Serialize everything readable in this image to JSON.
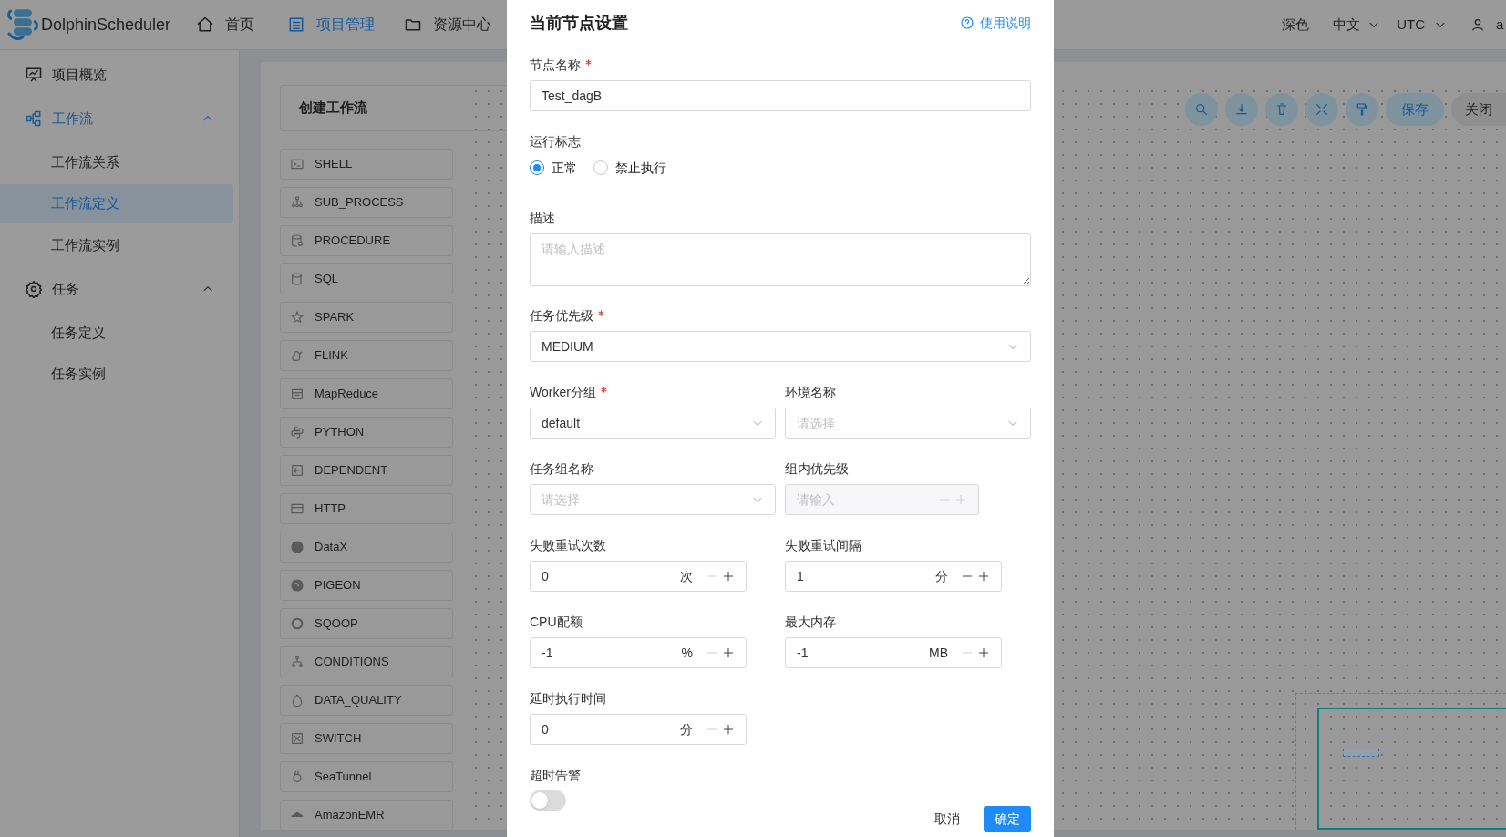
{
  "header": {
    "logo": "DolphinScheduler",
    "nav": [
      {
        "label": "首页",
        "selected": false
      },
      {
        "label": "项目管理",
        "selected": true
      },
      {
        "label": "资源中心",
        "selected": false
      }
    ],
    "theme": "深色",
    "language": "中文",
    "timezone": "UTC",
    "user": "a"
  },
  "sidebar": {
    "items": [
      {
        "label": "项目概览",
        "selected": false
      },
      {
        "label": "工作流",
        "expanded": true,
        "selected": true,
        "children": [
          {
            "label": "工作流关系",
            "selected": false
          },
          {
            "label": "工作流定义",
            "selected": true
          },
          {
            "label": "工作流实例",
            "selected": false
          }
        ]
      },
      {
        "label": "任务",
        "expanded": true,
        "selected": false,
        "children": [
          {
            "label": "任务定义",
            "selected": false
          },
          {
            "label": "任务实例",
            "selected": false
          }
        ]
      }
    ]
  },
  "toolbox": {
    "title": "创建工作流",
    "tools": [
      "SHELL",
      "SUB_PROCESS",
      "PROCEDURE",
      "SQL",
      "SPARK",
      "FLINK",
      "MapReduce",
      "PYTHON",
      "DEPENDENT",
      "HTTP",
      "DataX",
      "PIGEON",
      "SQOOP",
      "CONDITIONS",
      "DATA_QUALITY",
      "SWITCH",
      "SeaTunnel",
      "AmazonEMR"
    ]
  },
  "canvas_toolbar": {
    "buttons": [
      {
        "label": "保存",
        "kind": "primary"
      },
      {
        "label": "关闭",
        "kind": "plain"
      }
    ]
  },
  "drawer": {
    "title": "当前节点设置",
    "help": "使用说明",
    "fields": [
      {
        "kind": "text",
        "label": "节点名称",
        "required": true,
        "value": "Test_dagB"
      },
      {
        "kind": "radio",
        "label": "运行标志",
        "options": [
          {
            "label": "正常",
            "selected": true
          },
          {
            "label": "禁止执行",
            "selected": false
          }
        ]
      },
      {
        "kind": "textarea",
        "label": "描述",
        "placeholder": "请输入描述"
      },
      {
        "kind": "select",
        "label": "任务优先级",
        "required": true,
        "value": "MEDIUM"
      },
      {
        "kind": "row",
        "fields": [
          {
            "kind": "select",
            "label": "Worker分组",
            "required": true,
            "value": "default"
          },
          {
            "kind": "select",
            "label": "环境名称",
            "placeholder": "请选择"
          }
        ]
      },
      {
        "kind": "row",
        "fields": [
          {
            "kind": "select",
            "label": "任务组名称",
            "placeholder": "请选择"
          },
          {
            "kind": "number",
            "label": "组内优先级",
            "placeholder": "请输入",
            "disabled": true,
            "decrement_disabled": true
          }
        ]
      },
      {
        "kind": "row",
        "fields": [
          {
            "kind": "number",
            "label": "失败重试次数",
            "value": "0",
            "unit": "次",
            "decrement_disabled": true
          },
          {
            "kind": "number",
            "label": "失败重试间隔",
            "value": "1",
            "unit": "分",
            "decrement_disabled": false
          }
        ]
      },
      {
        "kind": "row",
        "fields": [
          {
            "kind": "number",
            "label": "CPU配额",
            "value": "-1",
            "unit": "%",
            "decrement_disabled": true
          },
          {
            "kind": "number",
            "label": "最大内存",
            "value": "-1",
            "unit": "MB",
            "decrement_disabled": true
          }
        ]
      },
      {
        "kind": "number",
        "label": "延时执行时间",
        "value": "0",
        "unit": "分",
        "decrement_disabled": true
      },
      {
        "kind": "switch",
        "label": "超时告警",
        "on": false
      }
    ],
    "buttons": [
      {
        "label": "取消",
        "kind": "plain"
      },
      {
        "label": "确定",
        "kind": "primary"
      }
    ]
  }
}
